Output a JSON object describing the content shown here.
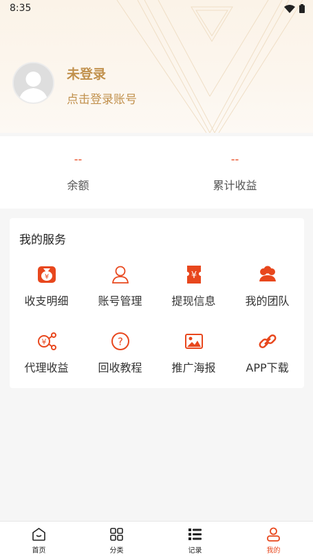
{
  "status_bar": {
    "time": "8:35",
    "wifi_icon": "wifi-icon",
    "battery_icon": "battery-icon"
  },
  "profile": {
    "title": "未登录",
    "subtitle": "点击登录账号",
    "avatar_icon": "default-avatar-icon"
  },
  "stats": [
    {
      "value": "--",
      "label": "余额"
    },
    {
      "value": "--",
      "label": "累计收益"
    }
  ],
  "services": {
    "title": "我的服务",
    "items": [
      {
        "label": "收支明细",
        "icon": "money-bag-icon"
      },
      {
        "label": "账号管理",
        "icon": "user-icon"
      },
      {
        "label": "提现信息",
        "icon": "yuan-ticket-icon"
      },
      {
        "label": "我的团队",
        "icon": "team-icon"
      },
      {
        "label": "代理收益",
        "icon": "share-yuan-icon"
      },
      {
        "label": "回收教程",
        "icon": "question-icon"
      },
      {
        "label": "推广海报",
        "icon": "image-icon"
      },
      {
        "label": "APP下载",
        "icon": "link-icon"
      }
    ]
  },
  "tabbar": {
    "items": [
      {
        "label": "首页",
        "icon": "home-icon",
        "active": false
      },
      {
        "label": "分类",
        "icon": "grid-icon",
        "active": false
      },
      {
        "label": "记录",
        "icon": "list-icon",
        "active": false
      },
      {
        "label": "我的",
        "icon": "person-icon",
        "active": true
      }
    ]
  },
  "colors": {
    "accent": "#e8471d",
    "gold": "#c1914d",
    "background": "#f6f6f6"
  }
}
